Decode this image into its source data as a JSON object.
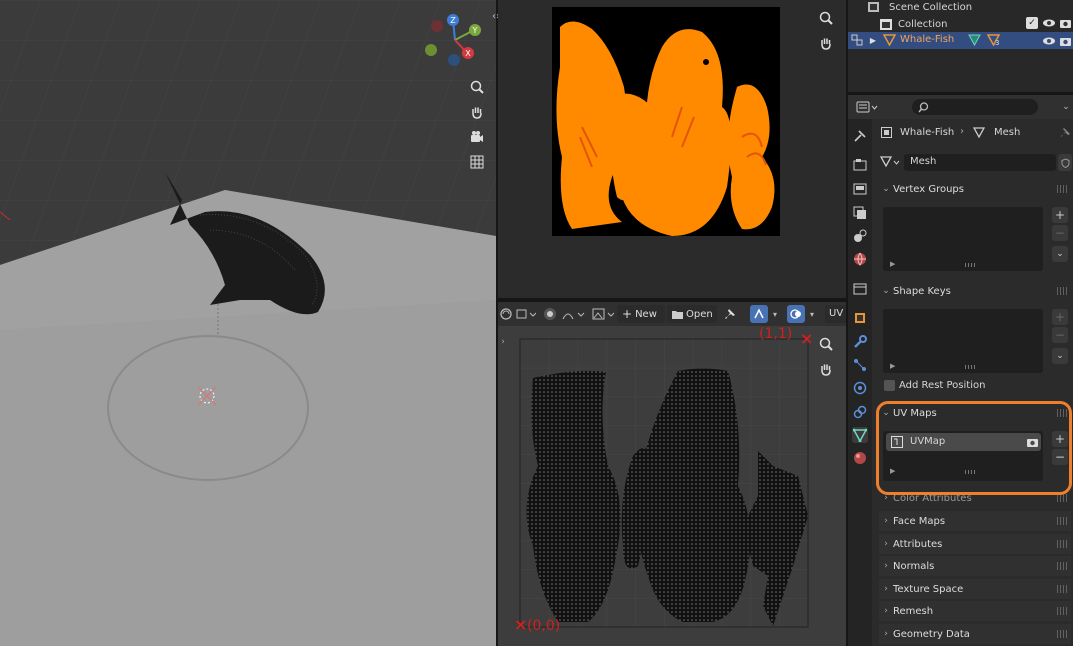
{
  "outliner": {
    "scene_collection": "Scene Collection",
    "collection": "Collection",
    "object_name": "Whale-Fish",
    "modifier_count": "3"
  },
  "viewport": {
    "gizmo_axes": {
      "z": "Z",
      "y": "Y",
      "x": "X"
    }
  },
  "uv_editor": {
    "new_label": "New",
    "open_label": "Open",
    "uv_menu": "UV",
    "coord_top": "(1,1)",
    "coord_bottom": "(0,0)"
  },
  "properties": {
    "breadcrumb_object": "Whale-Fish",
    "breadcrumb_data": "Mesh",
    "mesh_name": "Mesh",
    "panels": {
      "vertex_groups": "Vertex Groups",
      "shape_keys": "Shape Keys",
      "add_rest_position": "Add Rest Position",
      "uv_maps": "UV Maps",
      "uv_map_item": "UVMap",
      "color_attributes": "Color Attributes",
      "face_maps": "Face Maps",
      "attributes": "Attributes",
      "normals": "Normals",
      "texture_space": "Texture Space",
      "remesh": "Remesh",
      "geometry_data": "Geometry Data"
    }
  },
  "colors": {
    "highlight": "#ee7f2d",
    "selection": "#334d80",
    "texture_orange": "#ff8a00",
    "annotation_red": "#d21f1f"
  }
}
